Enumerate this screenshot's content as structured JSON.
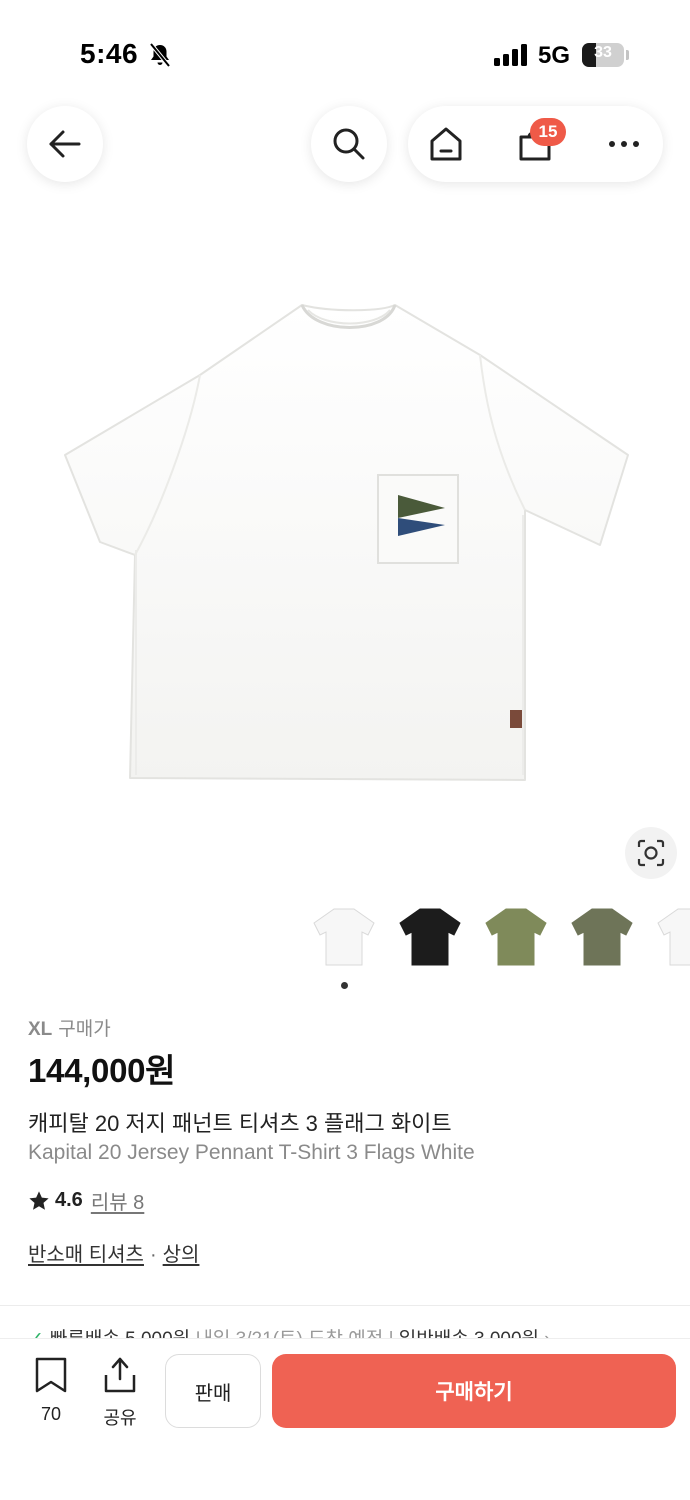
{
  "status_bar": {
    "time": "5:46",
    "network": "5G",
    "battery": "33",
    "battery_level": 0.33
  },
  "nav": {
    "back_icon": "arrow-left-icon",
    "search_icon": "search-icon",
    "home_icon": "home-icon",
    "cart_icon": "shopping-bag-icon",
    "cart_badge": "15",
    "more_icon": "more-horizontal-icon"
  },
  "product": {
    "size_label": "XL",
    "price_label": "구매가",
    "price": "144,000원",
    "name_ko": "캐피탈 20 저지 패넌트 티셔츠 3 플래그 화이트",
    "name_en": "Kapital 20 Jersey Pennant T-Shirt 3 Flags White",
    "rating": "4.6",
    "review_label": "리뷰 8",
    "category_1": "반소매 티셔츠",
    "category_sep": "·",
    "category_2": "상의"
  },
  "thumbnails": [
    {
      "name": "white",
      "color": "#f7f7f7"
    },
    {
      "name": "black",
      "color": "#1c1c1c"
    },
    {
      "name": "olive",
      "color": "#7f8a5a"
    },
    {
      "name": "khaki",
      "color": "#6e7458"
    },
    {
      "name": "white-2",
      "color": "#f7f7f7"
    }
  ],
  "delivery": {
    "fast_label": "빠른배송 5,000원",
    "fast_date": "내일 3/21(토) 도착 예정",
    "normal_label": "일반배송 3,000원"
  },
  "bottom_bar": {
    "wish_count": "70",
    "share_label": "공유",
    "sell_label": "판매",
    "buy_label": "구매하기"
  },
  "colors": {
    "accent": "#ef6253",
    "badge": "#ef5a48",
    "check": "#31b46a"
  }
}
